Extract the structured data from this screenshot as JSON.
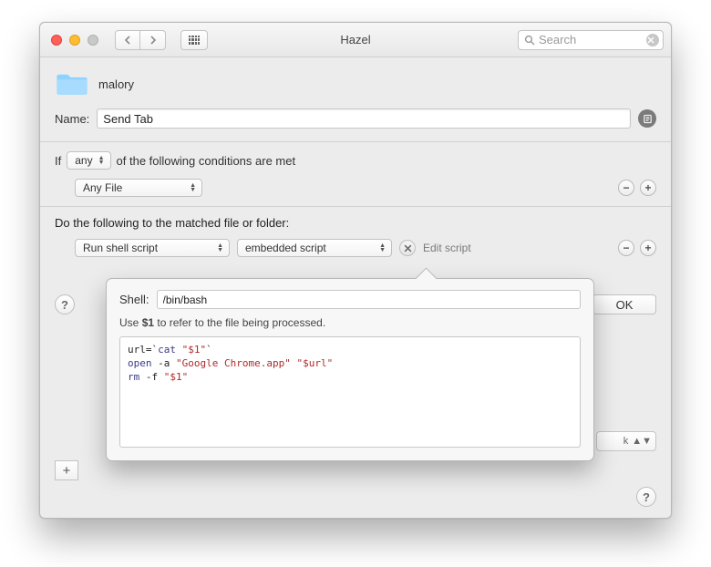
{
  "window": {
    "title": "Hazel",
    "search_placeholder": "Search"
  },
  "rule": {
    "folder_name": "malory",
    "name_label": "Name:",
    "name_value": "Send Tab"
  },
  "conditions": {
    "if_prefix": "If",
    "mode_popup": "any",
    "if_suffix": "of the following conditions are met",
    "rows": [
      {
        "subject": "Any File"
      }
    ]
  },
  "actions": {
    "header": "Do the following to the matched file or folder:",
    "rows": [
      {
        "action_popup": "Run shell script",
        "source_popup": "embedded script",
        "edit_label": "Edit script"
      }
    ]
  },
  "buttons": {
    "ok": "OK"
  },
  "popover": {
    "shell_label": "Shell:",
    "shell_value": "/bin/bash",
    "hint_pre": "Use ",
    "hint_var": "$1",
    "hint_post": " to refer to the file being processed.",
    "script_lines": [
      {
        "tokens": [
          {
            "t": "plain",
            "v": "url=`"
          },
          {
            "t": "cmd",
            "v": "cat"
          },
          {
            "t": "plain",
            "v": " "
          },
          {
            "t": "str",
            "v": "\"$1\""
          },
          {
            "t": "plain",
            "v": "`"
          }
        ]
      },
      {
        "tokens": [
          {
            "t": "cmd",
            "v": "open"
          },
          {
            "t": "plain",
            "v": " -a "
          },
          {
            "t": "str",
            "v": "\"Google Chrome.app\""
          },
          {
            "t": "plain",
            "v": " "
          },
          {
            "t": "str",
            "v": "\"$url\""
          }
        ]
      },
      {
        "tokens": [
          {
            "t": "cmd",
            "v": "rm"
          },
          {
            "t": "plain",
            "v": " -f "
          },
          {
            "t": "str",
            "v": "\"$1\""
          }
        ]
      }
    ]
  },
  "misc": {
    "sub_panel_text": "k"
  }
}
